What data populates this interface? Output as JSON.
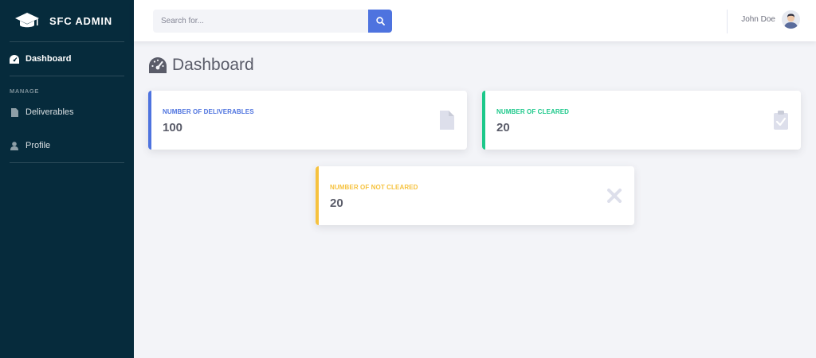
{
  "sidebar": {
    "brand": "SFC ADMIN",
    "items": [
      {
        "label": "Dashboard",
        "icon": "tachometer-icon",
        "active": true
      }
    ],
    "section": "MANAGE",
    "manage_items": [
      {
        "label": "Deliverables",
        "icon": "file-icon"
      },
      {
        "label": "Profile",
        "icon": "user-icon"
      }
    ]
  },
  "topbar": {
    "search_placeholder": "Search for...",
    "user_name": "John Doe"
  },
  "main": {
    "title": "Dashboard",
    "cards": [
      {
        "label": "NUMBER OF DELIVERABLES",
        "value": "100",
        "color": "#4e73df",
        "icon": "file-icon"
      },
      {
        "label": "NUMBER OF CLEARED",
        "value": "20",
        "color": "#1cc88a",
        "icon": "clipboard-check-icon"
      },
      {
        "label": "NUMBER OF NOT CLEARED",
        "value": "20",
        "color": "#f6c23e",
        "icon": "times-icon"
      }
    ]
  },
  "colors": {
    "sidebar_bg": "#062b3c",
    "primary": "#4e73df",
    "success": "#1cc88a",
    "warning": "#f6c23e",
    "page_bg": "#f3f4f8"
  }
}
